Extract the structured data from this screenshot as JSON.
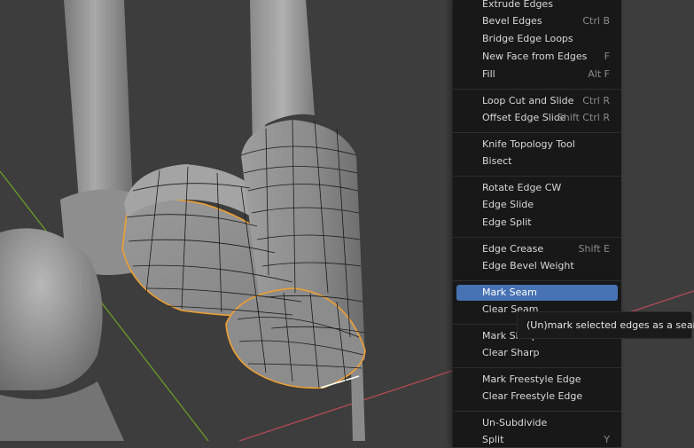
{
  "menu": {
    "items": [
      {
        "label": "Extrude Edges",
        "shortcut": ""
      },
      {
        "label": "Bevel Edges",
        "shortcut": "Ctrl B"
      },
      {
        "label": "Bridge Edge Loops",
        "shortcut": ""
      },
      {
        "label": "New Face from Edges",
        "shortcut": "F"
      },
      {
        "label": "Fill",
        "shortcut": "Alt F"
      },
      {
        "label": "Loop Cut and Slide",
        "shortcut": "Ctrl R"
      },
      {
        "label": "Offset Edge Slide",
        "shortcut": "Shift Ctrl R"
      },
      {
        "label": "Knife Topology Tool",
        "shortcut": ""
      },
      {
        "label": "Bisect",
        "shortcut": ""
      },
      {
        "label": "Rotate Edge CW",
        "shortcut": ""
      },
      {
        "label": "Edge Slide",
        "shortcut": ""
      },
      {
        "label": "Edge Split",
        "shortcut": ""
      },
      {
        "label": "Edge Crease",
        "shortcut": "Shift E"
      },
      {
        "label": "Edge Bevel Weight",
        "shortcut": ""
      },
      {
        "label": "Mark Seam",
        "shortcut": ""
      },
      {
        "label": "Clear Seam",
        "shortcut": ""
      },
      {
        "label": "Mark Sharp",
        "shortcut": ""
      },
      {
        "label": "Clear Sharp",
        "shortcut": ""
      },
      {
        "label": "Mark Freestyle Edge",
        "shortcut": ""
      },
      {
        "label": "Clear Freestyle Edge",
        "shortcut": ""
      },
      {
        "label": "Un-Subdivide",
        "shortcut": ""
      },
      {
        "label": "Split",
        "shortcut": "Y"
      }
    ],
    "highlighted": "Mark Seam"
  },
  "tooltip": {
    "text": "(Un)mark selected edges as a seam."
  },
  "colors": {
    "menu_bg": "#181818",
    "highlight": "#4772b3",
    "selection": "#f0a030",
    "axis_y": "#6e9a2a",
    "axis_x": "#b24a55"
  }
}
